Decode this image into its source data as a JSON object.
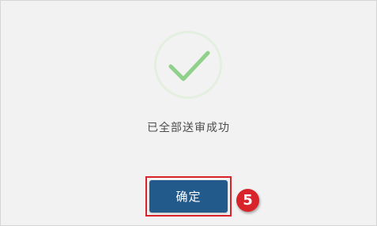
{
  "dialog": {
    "message": "已全部送审成功",
    "confirm_label": "确定",
    "step_number": "5"
  },
  "icons": {
    "success": "check-circle-icon"
  },
  "colors": {
    "background": "#f2f2f2",
    "icon_ring": "#e3efdf",
    "icon_check": "#8fd08a",
    "primary_button": "#235a8c",
    "highlight": "#d8232a"
  }
}
